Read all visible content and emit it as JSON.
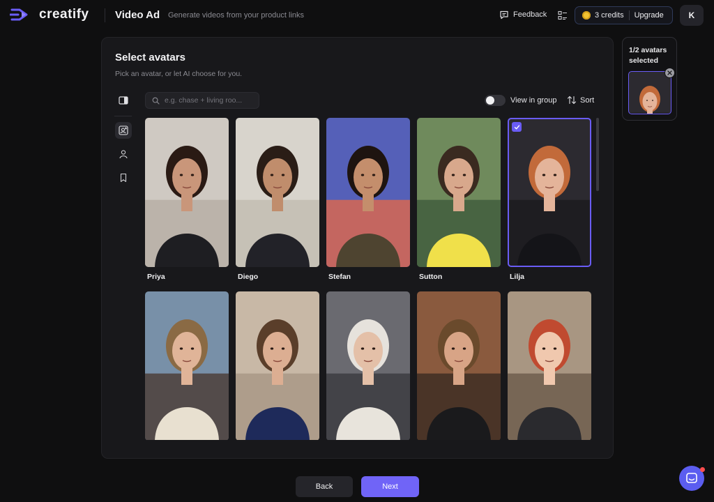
{
  "header": {
    "logo_text": "creatify",
    "title": "Video Ad",
    "subtitle": "Generate videos from your product links",
    "feedback_label": "Feedback",
    "credits_label": "3 credits",
    "upgrade_label": "Upgrade",
    "user_initial": "K"
  },
  "panel": {
    "title": "Select avatars",
    "subtitle": "Pick an avatar, or let AI choose for you.",
    "search_placeholder": "e.g. chase + living roo...",
    "view_group_label": "View in group",
    "sort_label": "Sort"
  },
  "avatars": [
    {
      "name": "Priya",
      "selected": false,
      "bg": "#cfc9c2",
      "bg2": "#b5aea4",
      "skin": "#c9967a",
      "hair": "#2a1a14",
      "shirt": "#1e1e22"
    },
    {
      "name": "Diego",
      "selected": false,
      "bg": "#d8d4cc",
      "bg2": "#c2bcb0",
      "skin": "#c08d6c",
      "hair": "#2a1d16",
      "shirt": "#222228"
    },
    {
      "name": "Stefan",
      "selected": false,
      "bg": "#5560b8",
      "bg2": "#e0684a",
      "skin": "#c48e6c",
      "hair": "#1e1410",
      "shirt": "#4e4430"
    },
    {
      "name": "Sutton",
      "selected": false,
      "bg": "#6f8a5c",
      "bg2": "#3e5a3c",
      "skin": "#d8a88c",
      "hair": "#3a2a20",
      "shirt": "#f0e04a"
    },
    {
      "name": "Lilja",
      "selected": true,
      "bg": "#2c2a30",
      "bg2": "#1b1a1e",
      "skin": "#e4b49a",
      "hair": "#c26a3a",
      "shirt": "#141418"
    },
    {
      "name": "",
      "selected": false,
      "bg": "#7890a8",
      "bg2": "#4a3a32",
      "skin": "#e0b498",
      "hair": "#8a6a44",
      "shirt": "#e8e0d0"
    },
    {
      "name": "",
      "selected": false,
      "bg": "#c8b8a6",
      "bg2": "#a89684",
      "skin": "#dcae92",
      "hair": "#5a3e2a",
      "shirt": "#1e2a5a"
    },
    {
      "name": "",
      "selected": false,
      "bg": "#6a6a70",
      "bg2": "#3a3a3e",
      "skin": "#e4c0a8",
      "hair": "#e6e2dc",
      "shirt": "#e8e4dc"
    },
    {
      "name": "",
      "selected": false,
      "bg": "#8a5a3e",
      "bg2": "#3a2a22",
      "skin": "#d8a486",
      "hair": "#6a4a2c",
      "shirt": "#1a1a1c"
    },
    {
      "name": "",
      "selected": false,
      "bg": "#a89682",
      "bg2": "#6a5a4a",
      "skin": "#f0c8ae",
      "hair": "#c04a30",
      "shirt": "#2a2a2e"
    }
  ],
  "selection": {
    "text": "1/2 avatars selected"
  },
  "footer": {
    "back_label": "Back",
    "next_label": "Next"
  }
}
